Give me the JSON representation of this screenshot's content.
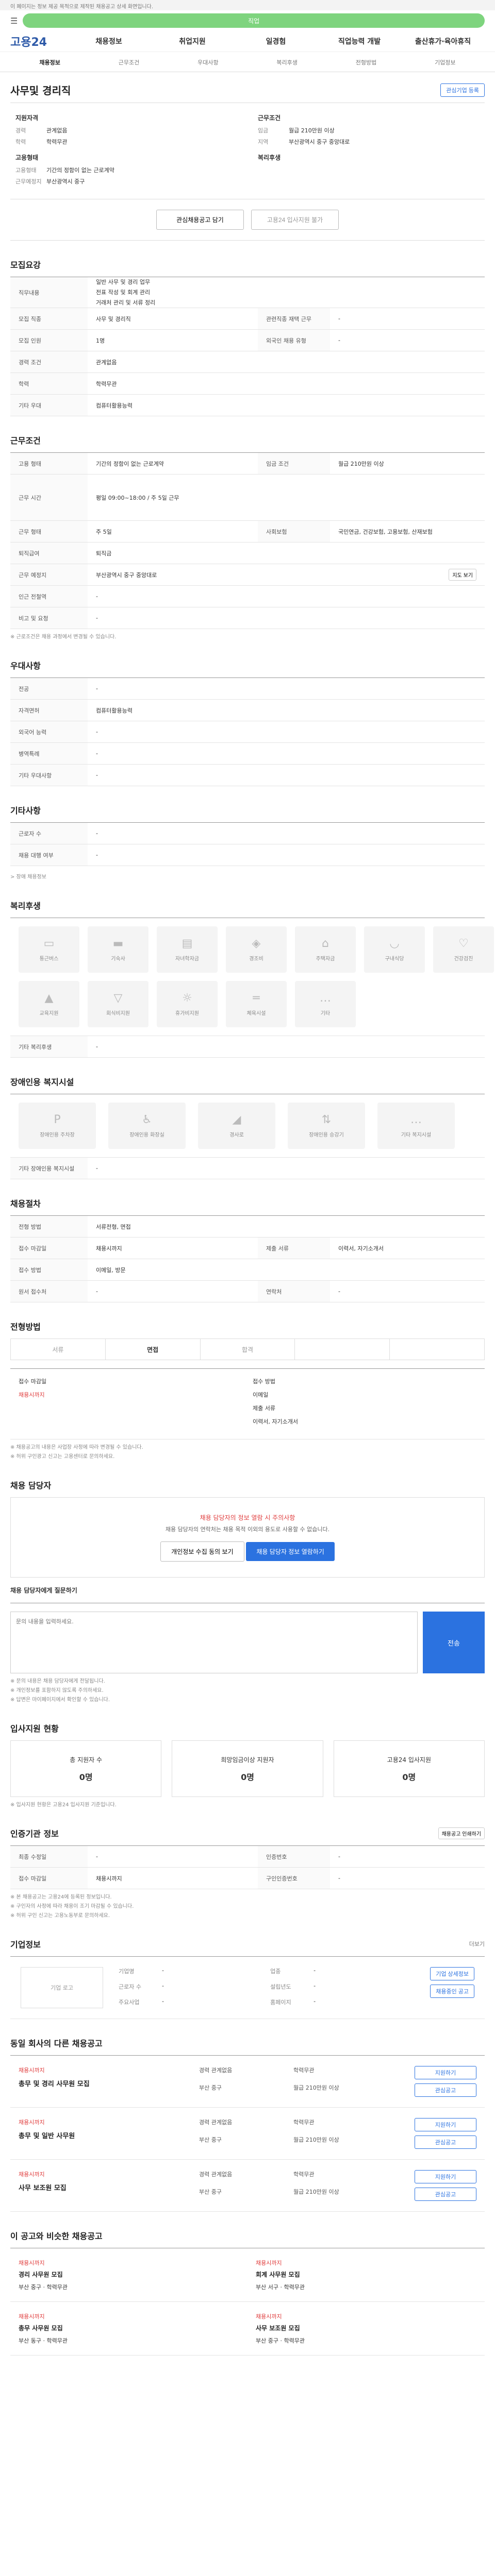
{
  "notice": "이 페이지는 정보 제공 목적으로 제작된 채용공고 상세 화면입니다.",
  "search": {
    "placeholder": "직업"
  },
  "brand": "고용24",
  "nav": [
    "채용정보",
    "취업지원",
    "일경험",
    "직업능력 개발",
    "출산휴가·육아휴직"
  ],
  "subnav": [
    "채용정보",
    "근무조건",
    "우대사항",
    "복리후생",
    "전형방법",
    "기업정보"
  ],
  "job_title": "사무및 경리직",
  "btn_interest": "관심기업 등록",
  "summary": {
    "qual_title": "지원자격",
    "qual": [
      {
        "k": "경력",
        "v": "관계없음"
      },
      {
        "k": "학력",
        "v": "학력무관"
      }
    ],
    "type_title": "고용형태",
    "type": [
      {
        "k": "고용형태",
        "v": "기간의 정함이 없는 근로계약"
      },
      {
        "k": "근무예정지",
        "v": "부산광역시 중구"
      }
    ],
    "cond_title": "근무조건",
    "cond": [
      {
        "k": "임금",
        "v": "월급 210만원 이상"
      },
      {
        "k": "지역",
        "v": "부산광역시 중구 중앙대로"
      }
    ],
    "benefit_title": "복리후생"
  },
  "actions": {
    "scrap": "관심채용공고 담기",
    "apply": "고용24 입사지원 불가"
  },
  "sec_recruit": {
    "title": "모집요강",
    "job_desc_label": "직무내용",
    "job_desc_lines": [
      "일반 사무 및 경리 업무",
      "전표 작성 및 회계 관리",
      "거래처 관리 및 서류 정리"
    ],
    "rows": [
      {
        "th": "모집 직종",
        "td": "사무 및 경리직",
        "th2": "관련직종 재택 근무",
        "td2": "-"
      },
      {
        "th": "모집 인원",
        "td": "1명",
        "th2": "외국인 채용 유형",
        "td2": "-"
      },
      {
        "th": "경력 조건",
        "td": "관계없음",
        "th2": "",
        "td2": ""
      },
      {
        "th": "학력",
        "td": "학력무관",
        "th2": "",
        "td2": ""
      },
      {
        "th": "기타 우대",
        "td": "컴퓨터활용능력",
        "th2": "",
        "td2": ""
      }
    ]
  },
  "sec_cond": {
    "title": "근무조건",
    "rows": [
      {
        "th": "고용 형태",
        "td": "기간의 정함이 없는 근로계약",
        "th2": "임금 조건",
        "td2": "월급 210만원 이상"
      },
      {
        "th": "근무 시간",
        "td": "평일 09:00~18:00 / 주 5일 근무",
        "th2": "",
        "td2": ""
      },
      {
        "th": "근무 형태",
        "td": "주 5일",
        "th2": "사회보험",
        "td2": "국민연금, 건강보험, 고용보험, 산재보험"
      },
      {
        "th": "퇴직급여",
        "td": "퇴직금",
        "th2": "",
        "td2": ""
      },
      {
        "th": "근무 예정지",
        "td": "부산광역시 중구 중앙대로",
        "th2": "",
        "td2": ""
      },
      {
        "th": "인근 전철역",
        "td": "-",
        "th2": "",
        "td2": ""
      },
      {
        "th": "비고 및 요청",
        "td": "-",
        "th2": "",
        "td2": ""
      }
    ],
    "map_btn": "지도 보기",
    "note": "※ 근로조건은 채용 과정에서 변경될 수 있습니다."
  },
  "sec_pref": {
    "title": "우대사항",
    "rows": [
      {
        "th": "전공",
        "td": "-"
      },
      {
        "th": "자격면허",
        "td": "컴퓨터활용능력"
      },
      {
        "th": "외국어 능력",
        "td": "-"
      },
      {
        "th": "병역특례",
        "td": "-"
      },
      {
        "th": "기타 우대사항",
        "td": "-"
      }
    ]
  },
  "sec_etc": {
    "title": "기타사항",
    "rows": [
      {
        "th": "근로자 수",
        "td": "-"
      },
      {
        "th": "채용 대행 여부",
        "td": "-"
      }
    ],
    "link": "> 장애 채용정보"
  },
  "sec_benefit": {
    "title": "복리후생",
    "items": [
      "통근버스",
      "기숙사",
      "자녀학자금",
      "경조비",
      "주택자금",
      "구내식당",
      "건강검진",
      "교육지원",
      "회식비지원",
      "휴가비지원",
      "체육시설",
      "기타"
    ],
    "note_label": "기타 복리후생",
    "note": "-"
  },
  "sec_disab": {
    "title": "장애인용 복지시설",
    "items": [
      "장애인용 주차장",
      "장애인용 화장실",
      "경사로",
      "장애인용 승강기",
      "기타 복지시설"
    ],
    "note_label": "기타 장애인용 복지시설",
    "note": "-"
  },
  "sec_apply": {
    "title": "채용절차",
    "rows": [
      {
        "th": "전형 방법",
        "td": "서류전형, 면접",
        "th2": "",
        "td2": ""
      },
      {
        "th": "접수 마감일",
        "td": "채용시까지",
        "th2": "제출 서류",
        "td2": "이력서, 자기소개서"
      },
      {
        "th": "접수 방법",
        "td": "이메일, 방문",
        "th2": "",
        "td2": ""
      },
      {
        "th": "원서 접수처",
        "td": "-",
        "th2": "연락처",
        "td2": "-"
      }
    ]
  },
  "sec_method": {
    "title": "전형방법",
    "tabs": [
      "서류",
      "면접",
      "합격",
      "",
      ""
    ],
    "deadline_label": "접수 마감일",
    "deadline_value": "채용시까지",
    "way_label": "접수 방법",
    "way_value": "이메일",
    "docs_label": "제출 서류",
    "docs_value": "이력서, 자기소개서",
    "notes": [
      "※ 채용공고의 내용은 사업장 사정에 따라 변경될 수 있습니다.",
      "※ 허위 구인광고 신고는 고용센터로 문의하세요."
    ]
  },
  "sec_contact": {
    "title": "채용 담당자",
    "warn1": "채용 담당자의 정보 열람 시 주의사항",
    "warn2": "채용 담당자의 연락처는 채용 목적 이외의 용도로 사용할 수 없습니다.",
    "btn_info": "개인정보 수집 동의 보기",
    "btn_view": "채용 담당자 정보 열람하기",
    "inquiry_title": "채용 담당자에게 질문하기",
    "inquiry_placeholder": "문의 내용을 입력하세요.",
    "send": "전송",
    "notes": [
      "※ 문의 내용은 채용 담당자에게 전달됩니다.",
      "※ 개인정보를 포함하지 않도록 주의하세요.",
      "※ 답변은 마이페이지에서 확인할 수 있습니다."
    ]
  },
  "sec_status": {
    "title": "입사지원 현황",
    "stats": [
      {
        "label": "총 지원자 수",
        "n": "0명"
      },
      {
        "label": "희망임금이상 지원자",
        "n": "0명"
      },
      {
        "label": "고용24 입사지원",
        "n": "0명"
      }
    ],
    "note": "※ 입사지원 현황은 고용24 입사지원 기준입니다."
  },
  "sec_info": {
    "title": "인증기관 정보",
    "print_btn": "채용공고 인쇄하기",
    "rows": [
      {
        "th": "최종 수정일",
        "td": "-",
        "th2": "인증번호",
        "td2": "-"
      },
      {
        "th": "접수 마감일",
        "td": "채용시까지",
        "th2": "구인인증번호",
        "td2": "-"
      }
    ],
    "notes": [
      "※ 본 채용공고는 고용24에 등록된 정보입니다.",
      "※ 구인자의 사정에 따라 채용이 조기 마감될 수 있습니다.",
      "※ 허위 구인 신고는 고용노동부로 문의하세요."
    ]
  },
  "sec_company": {
    "title": "기업정보",
    "more": "더보기",
    "logo": "기업 로고",
    "rows": [
      {
        "k": "기업명",
        "v": "-"
      },
      {
        "k": "업종",
        "v": "-"
      },
      {
        "k": "근로자 수",
        "v": "-"
      },
      {
        "k": "설립년도",
        "v": "-"
      },
      {
        "k": "주요사업",
        "v": "-"
      },
      {
        "k": "홈페이지",
        "v": "-"
      }
    ],
    "btn_detail": "기업 상세정보",
    "btn_jobs": "채용중인 공고"
  },
  "sec_same": {
    "title": "동일 회사의 다른 채용공고",
    "jobs": [
      {
        "co": "채용시까지",
        "title": "총무 및 경리 사무원 모집",
        "meta": [
          "경력 관계없음",
          "학력무관",
          "부산 중구",
          "월급 210만원 이상"
        ]
      },
      {
        "co": "채용시까지",
        "title": "총무 및 일반 사무원",
        "meta": [
          "경력 관계없음",
          "학력무관",
          "부산 중구",
          "월급 210만원 이상"
        ]
      },
      {
        "co": "채용시까지",
        "title": "사무 보조원 모집",
        "meta": [
          "경력 관계없음",
          "학력무관",
          "부산 중구",
          "월급 210만원 이상"
        ]
      }
    ],
    "btn_apply": "지원하기",
    "btn_scrap": "관심공고"
  },
  "sec_reco": {
    "title": "이 공고와 비슷한 채용공고",
    "items": [
      {
        "co": "채용시까지",
        "title": "경리 사무원 모집",
        "meta": "부산 중구 · 학력무관"
      },
      {
        "co": "채용시까지",
        "title": "회계 사무원 모집",
        "meta": "부산 서구 · 학력무관"
      },
      {
        "co": "채용시까지",
        "title": "총무 사무원 모집",
        "meta": "부산 동구 · 학력무관"
      },
      {
        "co": "채용시까지",
        "title": "사무 보조원 모집",
        "meta": "부산 중구 · 학력무관"
      }
    ]
  }
}
